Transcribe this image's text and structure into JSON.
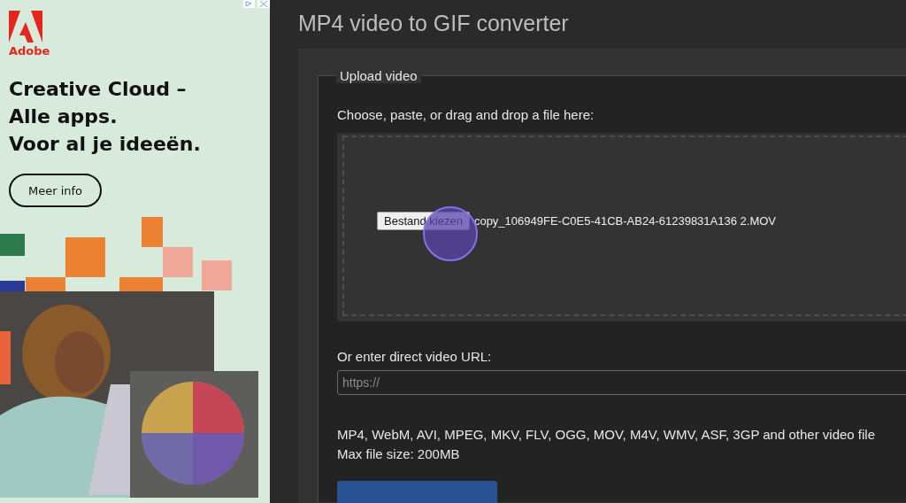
{
  "ad": {
    "brand": "Adobe",
    "headline": [
      "Creative Cloud –",
      "Alle apps.",
      "Voor al je ideeën."
    ],
    "button": "Meer info"
  },
  "page": {
    "title": "MP4 video to GIF converter"
  },
  "upload": {
    "legend": "Upload video",
    "instruction": "Choose, paste, or drag and drop a file here:",
    "file_button": "Bestand kiezen",
    "file_name": "copy_106949FE-C0E5-41CB-AB24-61239831A136 2.MOV",
    "url_label": "Or enter direct video URL:",
    "url_placeholder": "https://",
    "formats": "MP4, WebM, AVI, MPEG, MKV, FLV, OGG, MOV, M4V, WMV, ASF, 3GP and other video file",
    "max_size": "Max file size: 200MB"
  }
}
